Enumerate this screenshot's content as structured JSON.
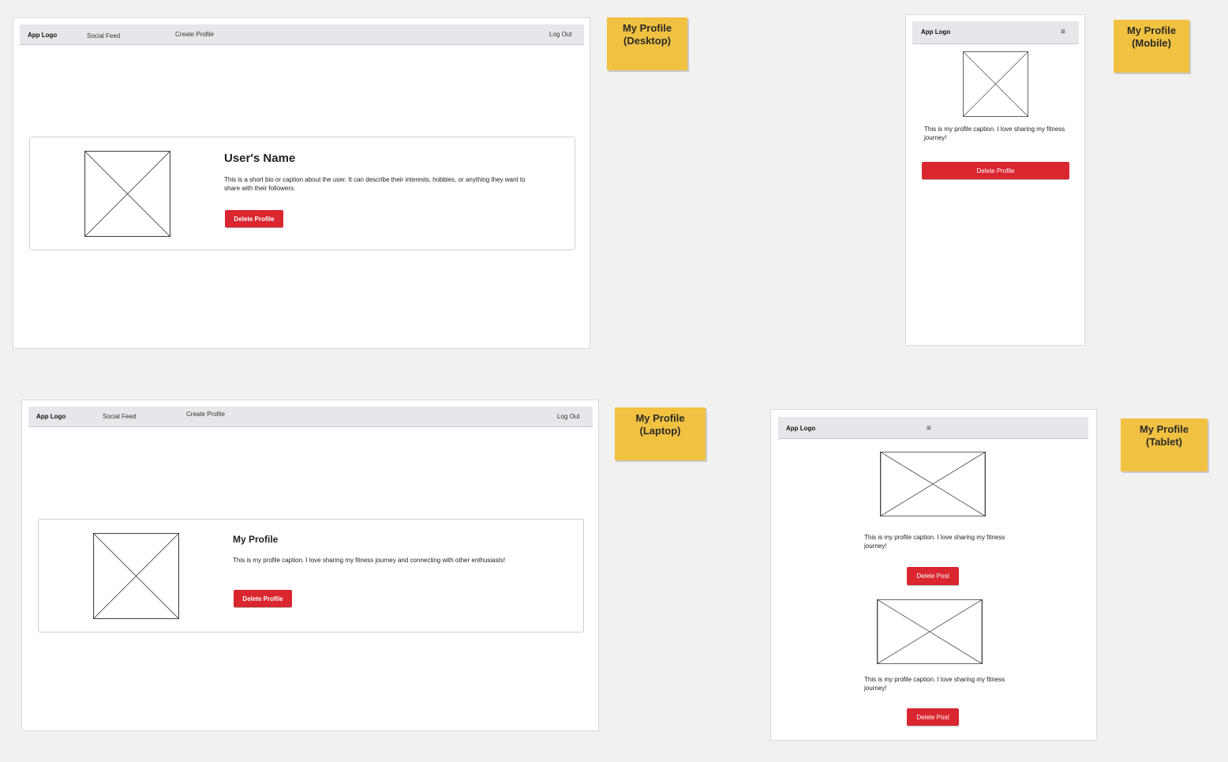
{
  "colors": {
    "canvas": "#f1f1f1",
    "navbar": "#e6e7ea",
    "danger_button": "#d9262f",
    "sticky_note": "#f1c142"
  },
  "desktop": {
    "nav": {
      "logo": "App Logo",
      "social_feed": "Social Feed",
      "create_profile": "Create Profile",
      "log_out": "Log Out"
    },
    "title": "User's Name",
    "caption": "This is a short bio or caption about the user. It can describe their interests, hobbies, or anything they want to share with their followers.",
    "button": "Delete Profile",
    "note": [
      "My Profile",
      "(Desktop)"
    ]
  },
  "mobile": {
    "nav": {
      "logo": "App Logo",
      "menu_icon": "hamburger-menu-icon"
    },
    "caption": "This is my profile caption. I love sharing my fitness journey!",
    "button": "Delete Profile",
    "note": [
      "My Profile",
      "(Mobile)"
    ]
  },
  "laptop": {
    "nav": {
      "logo": "App Logo",
      "social_feed": "Social Feed",
      "create_profile": "Create Profile",
      "log_out": "Log Out"
    },
    "title": "My Profile",
    "caption": "This is my profile caption. I love sharing my fitness journey and connecting with other enthusiasts!",
    "button": "Delete Profile",
    "note": [
      "My Profile",
      "(Laptop)"
    ]
  },
  "tablet": {
    "nav": {
      "logo": "App Logo",
      "menu_icon": "hamburger-menu-icon"
    },
    "posts": [
      {
        "caption": "This is my profile caption. I love sharing my fitness journey!",
        "button": "Delete Post"
      },
      {
        "caption": "This is my profile caption. I love sharing my fitness journey!",
        "button": "Delete Post"
      }
    ],
    "note": [
      "My Profile",
      "(Tablet)"
    ]
  }
}
